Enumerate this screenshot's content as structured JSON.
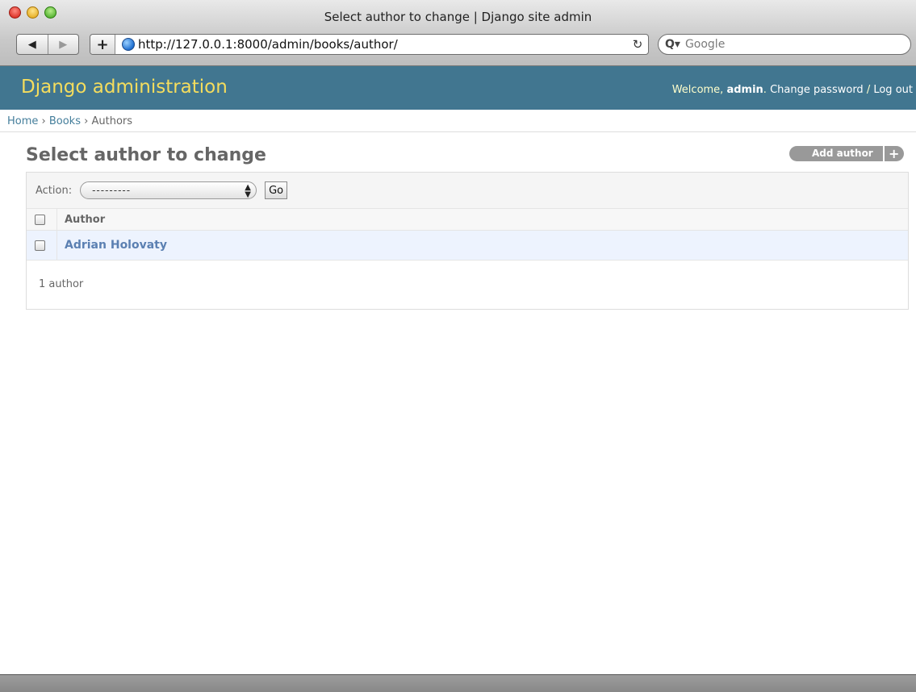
{
  "browser": {
    "window_title": "Select author to change | Django site admin",
    "back_glyph": "◀",
    "forward_glyph": "▶",
    "add_tab_glyph": "+",
    "url": "http://127.0.0.1:8000/admin/books/author/",
    "reload_glyph": "↻",
    "search_placeholder": "Google",
    "search_glyph": "Q▾"
  },
  "header": {
    "site_name": "Django administration",
    "welcome_text": "Welcome, ",
    "username": "admin",
    "period": ". ",
    "change_password": "Change password",
    "separator": " / ",
    "logout": "Log out"
  },
  "breadcrumbs": {
    "home": "Home",
    "sep": " › ",
    "app": "Books",
    "current": "Authors"
  },
  "content": {
    "title": "Select author to change",
    "add_button": "Add author",
    "add_glyph": "+"
  },
  "actions": {
    "label": "Action:",
    "selected": "---------",
    "go_button": "Go"
  },
  "table": {
    "column_header": "Author",
    "rows": [
      {
        "author": "Adrian Holovaty"
      }
    ]
  },
  "paginator": {
    "text": "1 author"
  },
  "colors": {
    "header_bg": "#417690",
    "site_name": "#f5dd5d",
    "link": "#447e9b",
    "row_bg": "#edf3fe"
  }
}
